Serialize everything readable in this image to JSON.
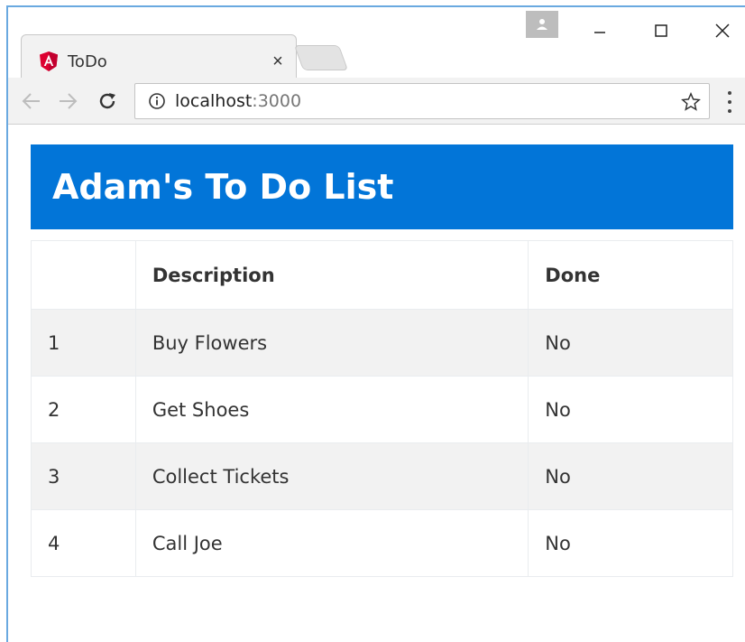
{
  "browser": {
    "tab_title": "ToDo",
    "tab_close": "×",
    "url_host": "localhost",
    "url_port": ":3000",
    "accent_color": "#dd0031"
  },
  "page": {
    "title": "Adam's To Do List",
    "header_color": "#0275d8",
    "columns": [
      "",
      "Description",
      "Done"
    ],
    "rows": [
      {
        "num": "1",
        "description": "Buy Flowers",
        "done": "No"
      },
      {
        "num": "2",
        "description": "Get Shoes",
        "done": "No"
      },
      {
        "num": "3",
        "description": "Collect Tickets",
        "done": "No"
      },
      {
        "num": "4",
        "description": "Call Joe",
        "done": "No"
      }
    ]
  },
  "icons": {
    "favicon": "angular-icon",
    "profile": "person-icon",
    "minimize": "minimize-icon",
    "maximize": "maximize-icon",
    "close": "close-icon",
    "back": "back-arrow-icon",
    "forward": "forward-arrow-icon",
    "reload": "reload-icon",
    "info": "info-icon",
    "bookmark": "star-icon",
    "menu": "kebab-menu-icon"
  }
}
